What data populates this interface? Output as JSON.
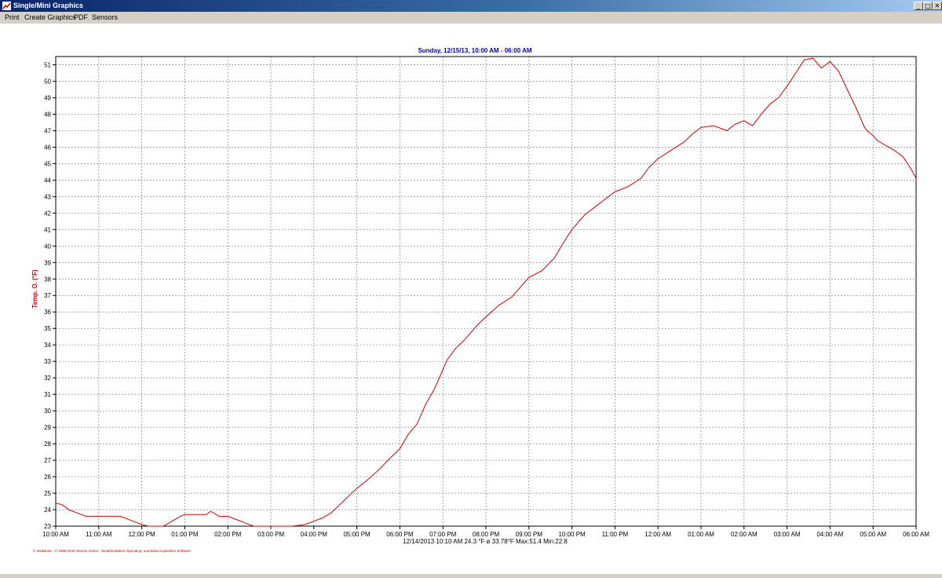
{
  "window": {
    "title": "Single/Mini Graphics",
    "minimize": "_",
    "maximize": "□",
    "close": "✕"
  },
  "menu": [
    "Print",
    "Create Graphics",
    "PDF",
    "Sensors"
  ],
  "footer": {
    "stats": "12/14/2013 10:10 AM  24.3 °F   ø 33.78°F  Max:51.4  Min:22.8",
    "copyright": "© WsWin32 · © 1999-2010 Werner Krenn · Weatherstation Operating- and Data Acquisition Software"
  },
  "colors": {
    "series": "#cc0000",
    "title": "#0000aa",
    "axis_label": "#cc0000",
    "titlebar": "#0a246a"
  },
  "chart_data": {
    "type": "line",
    "title": "Sunday, 12/15/13, 10:00 AM - 06:00 AM",
    "xlabel": "",
    "ylabel": "Temp. O. (°F)",
    "ylim": [
      23,
      51.5
    ],
    "yticks": [
      23,
      24,
      25,
      26,
      27,
      28,
      29,
      30,
      31,
      32,
      33,
      34,
      35,
      36,
      37,
      38,
      39,
      40,
      41,
      42,
      43,
      44,
      45,
      46,
      47,
      48,
      49,
      50,
      51
    ],
    "xlim": [
      0,
      20
    ],
    "xticks": [
      "10:00 AM",
      "11:00 AM",
      "12:00 PM",
      "01:00 PM",
      "02:00 PM",
      "03:00 PM",
      "04:00 PM",
      "05:00 PM",
      "06:00 PM",
      "07:00 PM",
      "08:00 PM",
      "09:00 PM",
      "10:00 PM",
      "11:00 PM",
      "12:00 AM",
      "01:00 AM",
      "02:00 AM",
      "03:00 AM",
      "04:00 AM",
      "05:00 AM",
      "06:00 AM"
    ],
    "grid": true,
    "series": [
      {
        "color": "#cc0000",
        "x": [
          0,
          0.15,
          0.3,
          0.5,
          0.7,
          1,
          1.5,
          1.8,
          2,
          2.15,
          2.3,
          2.5,
          2.7,
          2.9,
          3,
          3.3,
          3.5,
          3.6,
          3.8,
          4,
          4.2,
          4.4,
          4.6,
          4.8,
          5,
          5.2,
          5.5,
          5.8,
          6,
          6.2,
          6.4,
          6.6,
          6.8,
          7,
          7.2,
          7.5,
          7.8,
          8,
          8.2,
          8.4,
          8.6,
          8.8,
          9,
          9.1,
          9.3,
          9.5,
          9.8,
          10,
          10.3,
          10.6,
          10.8,
          11,
          11.3,
          11.6,
          11.8,
          12,
          12.3,
          12.6,
          12.8,
          13,
          13.3,
          13.6,
          13.8,
          14,
          14.3,
          14.6,
          14.8,
          15,
          15.3,
          15.6,
          15.8,
          16,
          16.2,
          16.4,
          16.6,
          16.8,
          17,
          17.2,
          17.4,
          17.6,
          17.8,
          18,
          18.2,
          18.4,
          18.6,
          18.7,
          18.8,
          18.9,
          19,
          19.1,
          19.3,
          19.5,
          19.7,
          19.9,
          20
        ],
        "values": [
          24.4,
          24.3,
          24,
          23.8,
          23.6,
          23.6,
          23.6,
          23.3,
          23.1,
          23,
          23,
          23,
          23.3,
          23.6,
          23.7,
          23.7,
          23.7,
          23.9,
          23.6,
          23.6,
          23.4,
          23.2,
          23,
          22.9,
          22.9,
          22.9,
          22.9,
          23.1,
          23.3,
          23.5,
          23.8,
          24.3,
          24.8,
          25.3,
          25.7,
          26.4,
          27.2,
          27.7,
          28.6,
          29.2,
          30.4,
          31.3,
          32.5,
          33.1,
          33.8,
          34.3,
          35.2,
          35.7,
          36.4,
          36.9,
          37.5,
          38.1,
          38.5,
          39.3,
          40.2,
          41,
          41.9,
          42.5,
          42.9,
          43.3,
          43.6,
          44.1,
          44.8,
          45.3,
          45.8,
          46.3,
          46.8,
          47.2,
          47.3,
          47,
          47.4,
          47.6,
          47.3,
          48,
          48.6,
          49,
          49.7,
          50.5,
          51.3,
          51.4,
          50.8,
          51.2,
          50.6,
          49.5,
          48.4,
          47.8,
          47.2,
          46.9,
          46.7,
          46.4,
          46.1,
          45.8,
          45.4,
          44.6,
          44.1
        ]
      }
    ]
  }
}
